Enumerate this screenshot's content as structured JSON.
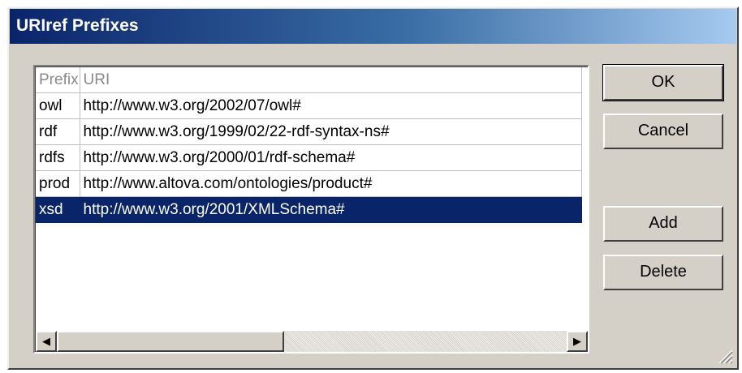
{
  "dialog": {
    "title": "URIref Prefixes"
  },
  "table": {
    "columns": [
      "Prefix",
      "URI"
    ],
    "rows": [
      {
        "prefix": "owl",
        "uri": "http://www.w3.org/2002/07/owl#"
      },
      {
        "prefix": "rdf",
        "uri": "http://www.w3.org/1999/02/22-rdf-syntax-ns#"
      },
      {
        "prefix": "rdfs",
        "uri": "http://www.w3.org/2000/01/rdf-schema#"
      },
      {
        "prefix": "prod",
        "uri": "http://www.altova.com/ontologies/product#"
      },
      {
        "prefix": "xsd",
        "uri": "http://www.w3.org/2001/XMLSchema#"
      }
    ],
    "selected_row": "xsd"
  },
  "buttons": {
    "ok": "OK",
    "cancel": "Cancel",
    "add": "Add",
    "delete": "Delete"
  },
  "scrollbar": {
    "left_arrow": "◀",
    "right_arrow": "▶"
  },
  "colors": {
    "selection": "#0a246a",
    "title_gradient_start": "#0a246a",
    "title_gradient_end": "#a6caf0",
    "dialog_face": "#d4d0c8"
  }
}
